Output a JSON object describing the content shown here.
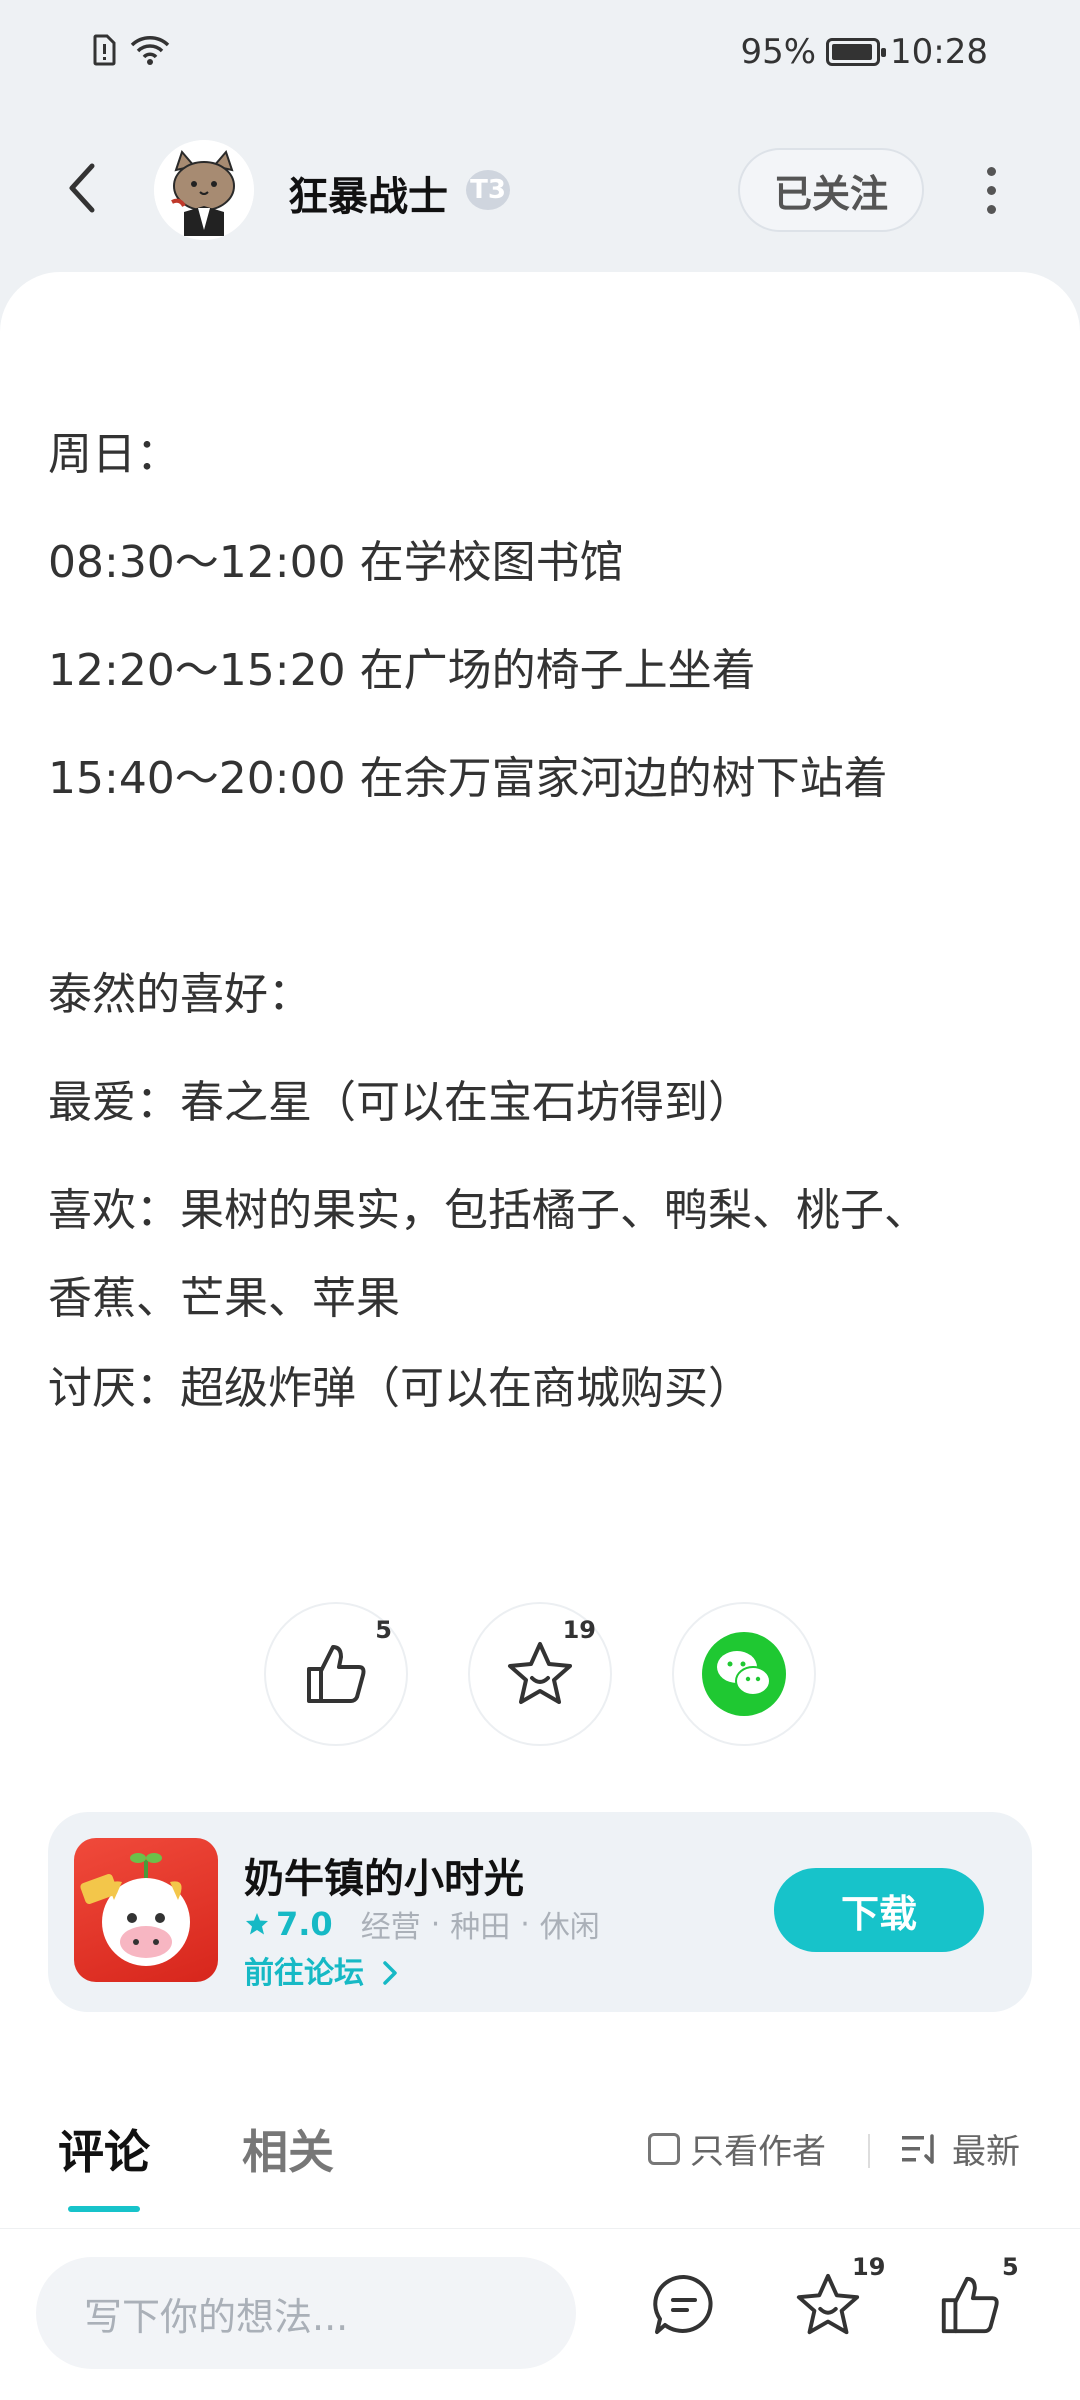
{
  "status_bar": {
    "battery_percent": "95%",
    "battery_level": 0.95,
    "time": "10:28",
    "icons": [
      "sim-alert-icon",
      "wifi-icon"
    ]
  },
  "header": {
    "username": "狂暴战士",
    "level_badge": "T3",
    "follow_label": "已关注"
  },
  "article": {
    "lines": [
      "周日：",
      "08:30～12:00 在学校图书馆",
      "12:20～15:20 在广场的椅子上坐着",
      "15:40～20:00 在余万富家河边的树下站着",
      "泰然的喜好：",
      "最爱：春之星（可以在宝石坊得到）",
      "喜欢：果树的果实，包括橘子、鸭梨、桃子、",
      "香蕉、芒果、苹果",
      "讨厌：超级炸弹（可以在商城购买）"
    ]
  },
  "actions": {
    "like_count": "5",
    "favorite_count": "19"
  },
  "game": {
    "title": "奶牛镇的小时光",
    "rating": "7.0",
    "tags": [
      "经营",
      "种田",
      "休闲"
    ],
    "forum_link": "前往论坛",
    "download_label": "下载",
    "accent": "#17c3ca"
  },
  "tabs": {
    "comments": "评论",
    "related": "相关",
    "author_only": "只看作者",
    "sort": "最新"
  },
  "bottom": {
    "placeholder": "写下你的想法...",
    "favorite_count": "19",
    "like_count": "5"
  }
}
